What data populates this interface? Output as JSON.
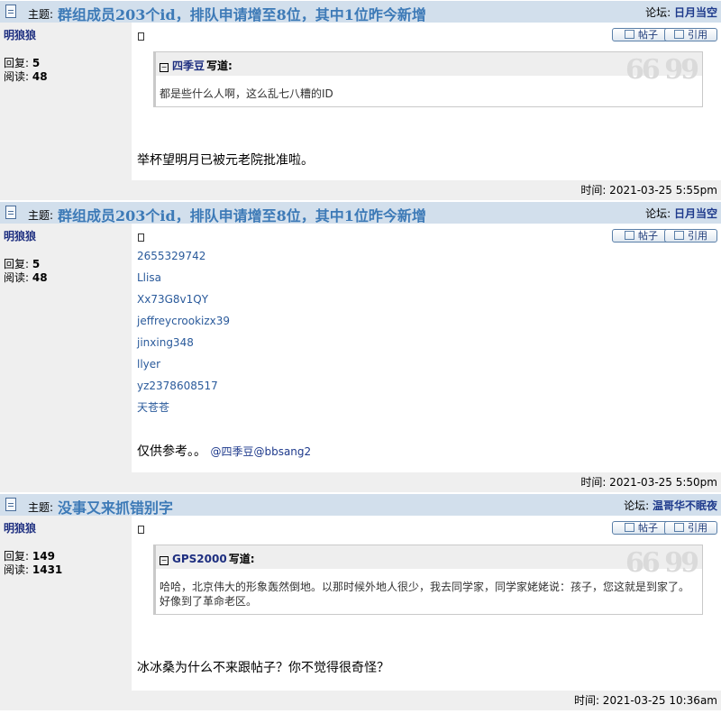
{
  "posts": [
    {
      "topic_label": "主题:",
      "title": "群组成员203个id，排队申请增至8位，其中1位昨今新增",
      "forum_label": "论坛:",
      "forum": "日月当空",
      "author": "明狼狼",
      "replies_label": "回复:",
      "replies": "5",
      "views_label": "阅读:",
      "views": "48",
      "btn_post": "帖子",
      "btn_quote": "引用",
      "quote_who": "四季豆",
      "quote_wrote": "写道:",
      "quote_text": "都是些什么人啊，这么乱七八糟的ID",
      "message": "举杯望明月已被元老院批准啦。",
      "time": "时间: 2021-03-25 5:55pm"
    },
    {
      "topic_label": "主题:",
      "title": "群组成员203个id，排队申请增至8位，其中1位昨今新增",
      "forum_label": "论坛:",
      "forum": "日月当空",
      "author": "明狼狼",
      "replies_label": "回复:",
      "replies": "5",
      "views_label": "阅读:",
      "views": "48",
      "btn_post": "帖子",
      "btn_quote": "引用",
      "ids": [
        "2655329742",
        "Llisa",
        "Xx73G8v1QY",
        "jeffreycrookizx39",
        "jinxing348",
        "llyer",
        "yz2378608517",
        "天苍苍"
      ],
      "message": "仅供参考。。",
      "mentions": "@四季豆@bbsang2",
      "time": "时间: 2021-03-25 5:50pm"
    },
    {
      "topic_label": "主题:",
      "title": "没事又来抓错别字",
      "forum_label": "论坛:",
      "forum": "温哥华不眠夜",
      "author": "明狼狼",
      "replies_label": "回复:",
      "replies": "149",
      "views_label": "阅读:",
      "views": "1431",
      "btn_post": "帖子",
      "btn_quote": "引用",
      "quote_who": "GPS2000",
      "quote_wrote": "写道:",
      "quote_text": "哈哈，北京伟大的形象轰然倒地。以那时候外地人很少，我去同学家，同学家姥姥说：孩子，您这就是到家了。好像到了革命老区。",
      "message": "冰冰桑为什么不来跟帖子？你不觉得很奇怪？",
      "time": "时间: 2021-03-25 10:36am"
    }
  ]
}
